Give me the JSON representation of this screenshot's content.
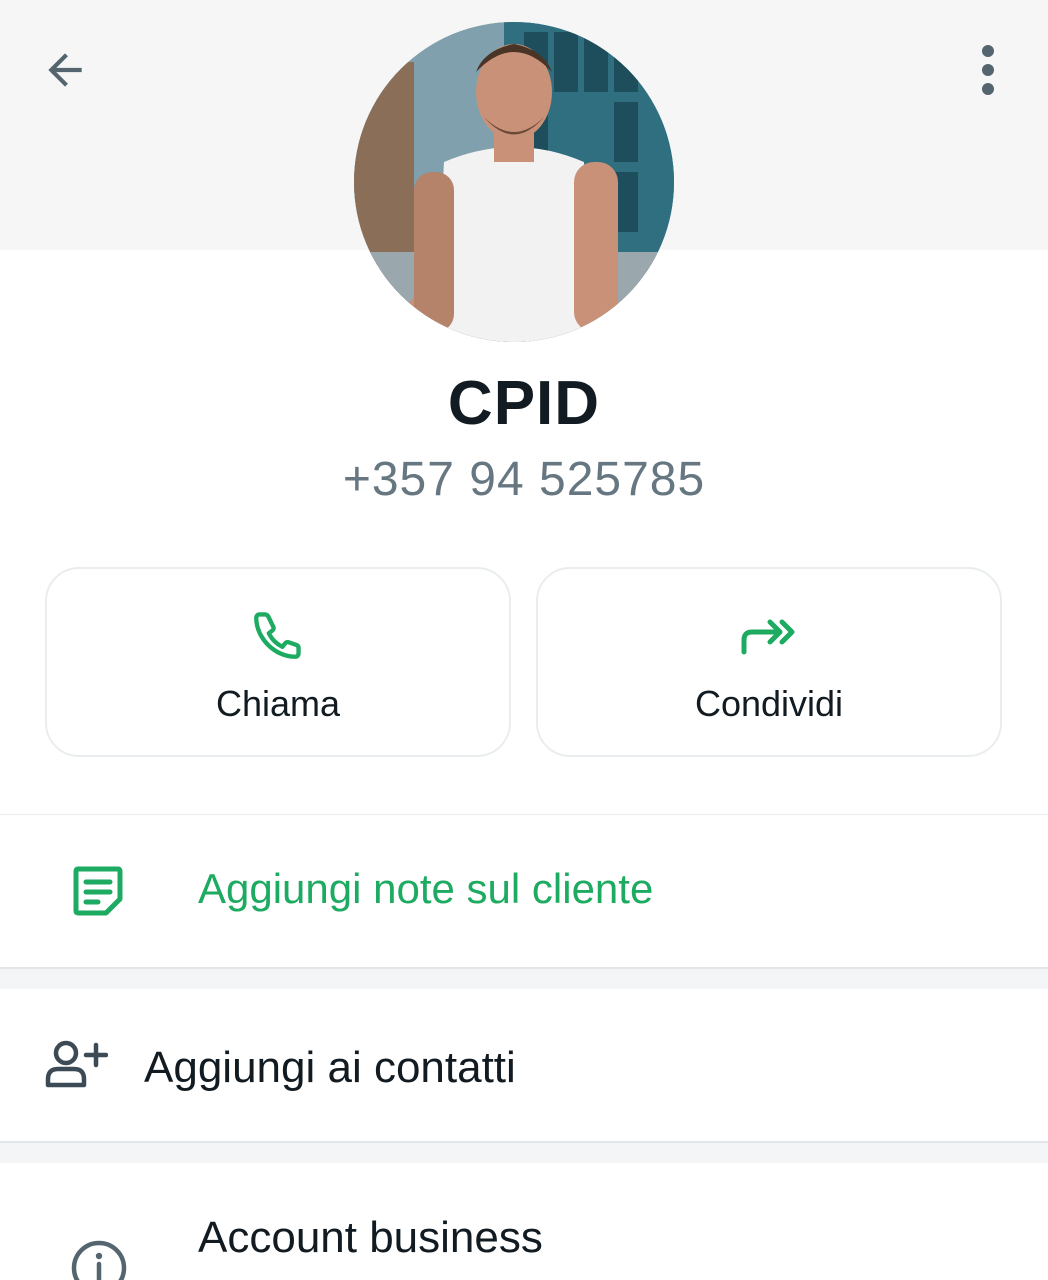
{
  "header": {
    "back_icon": "arrow-left-icon",
    "menu_icon": "more-vert-icon"
  },
  "profile": {
    "name": "CPID",
    "phone": "+357 94 525785"
  },
  "actions": [
    {
      "label": "Chiama",
      "icon": "phone-icon"
    },
    {
      "label": "Condividi",
      "icon": "share-forward-icon"
    }
  ],
  "notes_row": {
    "label": "Aggiungi note sul cliente",
    "icon": "note-icon"
  },
  "add_contact_row": {
    "label": "Aggiungi ai contatti",
    "icon": "add-person-icon"
  },
  "business_row": {
    "label": "Account business",
    "icon": "info-icon"
  },
  "colors": {
    "accent_green": "#1daa61",
    "text_primary": "#111b21",
    "text_secondary": "#667781",
    "icon_gray": "#54656f"
  }
}
